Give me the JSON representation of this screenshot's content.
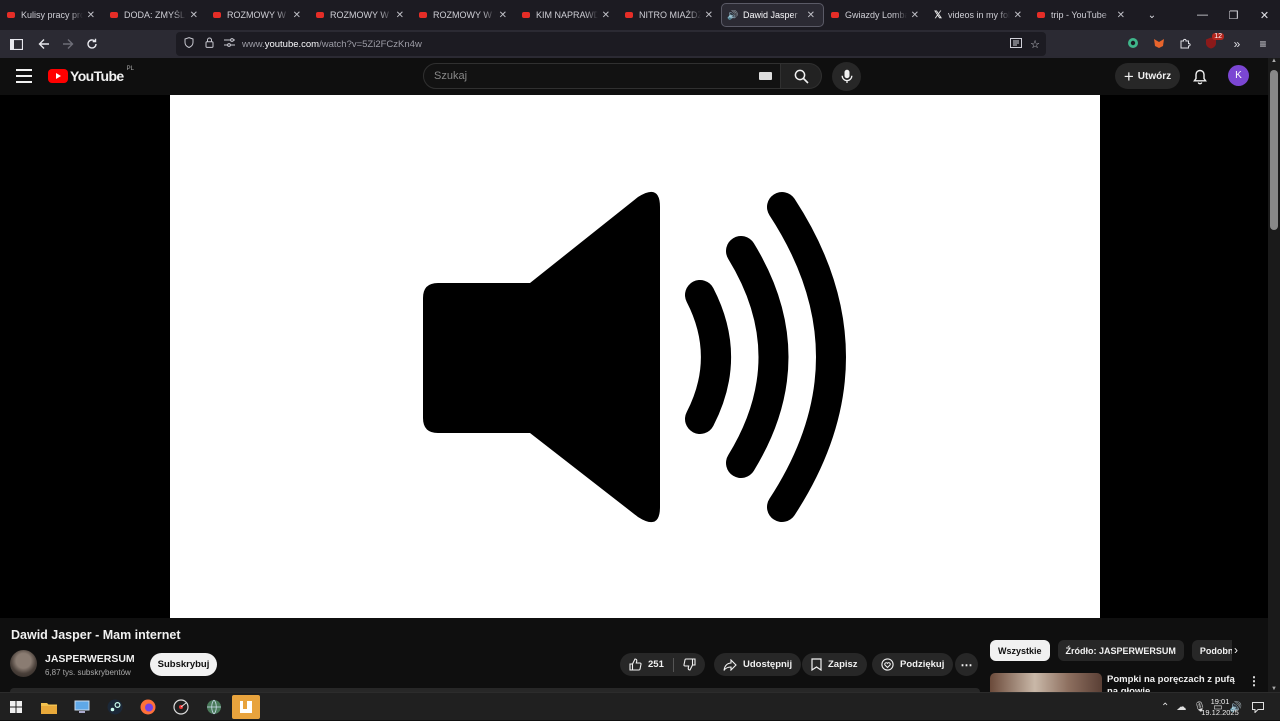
{
  "browser": {
    "tabs": [
      {
        "title": "Kulisy pracy prosty",
        "icon": "youtube-icon",
        "active": false
      },
      {
        "title": "DODA: ZMYŚLONE",
        "icon": "youtube-icon",
        "active": false
      },
      {
        "title": "ROZMOWY W TOK",
        "icon": "youtube-icon",
        "active": false
      },
      {
        "title": "ROZMOWY W TOK",
        "icon": "youtube-icon",
        "active": false
      },
      {
        "title": "ROZMOWY W TOK",
        "icon": "youtube-icon",
        "active": false
      },
      {
        "title": "KIM NAPRAWDĘ J",
        "icon": "youtube-icon",
        "active": false
      },
      {
        "title": "NITRO MIAŻDŻY",
        "icon": "youtube-icon",
        "active": false
      },
      {
        "title": "Dawid Jasper",
        "icon": "speaker-icon",
        "active": true
      },
      {
        "title": "Gwiazdy Lombardu",
        "icon": "youtube-icon",
        "active": false
      },
      {
        "title": "videos in my folder",
        "icon": "x-icon",
        "active": false
      },
      {
        "title": "trip - YouTube",
        "icon": "youtube-icon",
        "active": false
      }
    ],
    "url_prefix": "www.",
    "url_domain": "youtube.com",
    "url_path": "/watch?v=5Zi2FCzKn4w",
    "extensions_badge": "12"
  },
  "youtube": {
    "logo_text": "YouTube",
    "country_code": "PL",
    "search_placeholder": "Szukaj",
    "create_label": "Utwórz",
    "avatar_letter": "K",
    "video_title": "Dawid Jasper - Mam internet",
    "channel_name": "JASPERWERSUM",
    "subscribers": "6,87 tys. subskrybentów",
    "subscribe_label": "Subskrybuj",
    "like_count": "251",
    "share_label": "Udostępnij",
    "save_label": "Zapisz",
    "thanks_label": "Podziękuj",
    "chips": [
      "Wszystkie",
      "Źródło: JASPERWERSUM",
      "Podobne"
    ],
    "recommended_title": "Pompki na poręczach z pufą na głowie"
  },
  "taskbar": {
    "time": "19:01",
    "date": "19.12.2025"
  },
  "colors": {
    "youtube_red": "#ff0000",
    "avatar_purple": "#7b46d3",
    "dark_bg": "#0f0f0f"
  }
}
